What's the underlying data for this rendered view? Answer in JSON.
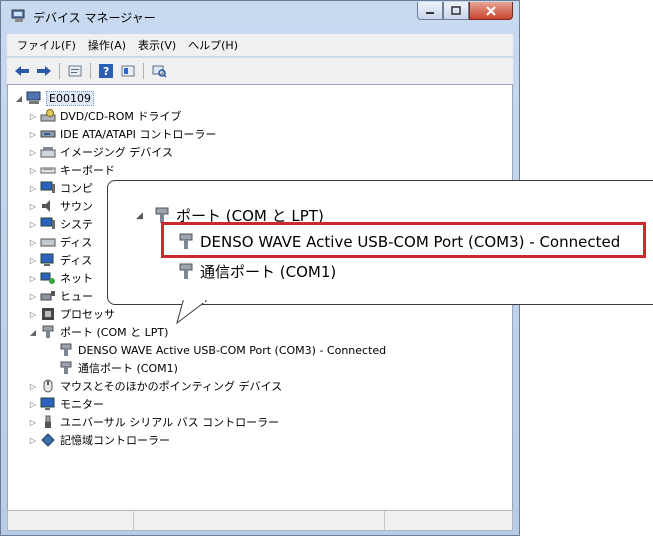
{
  "window": {
    "title": "デバイス マネージャー"
  },
  "menu": [
    "ファイル(F)",
    "操作(A)",
    "表示(V)",
    "ヘルプ(H)"
  ],
  "tree": {
    "root": "E00109",
    "items": [
      "DVD/CD-ROM ドライブ",
      "IDE ATA/ATAPI コントローラー",
      "イメージング デバイス",
      "キーボード",
      "コンピ",
      "サウン",
      "システ",
      "ディス",
      "ディス",
      "ネット",
      "ヒュー",
      "プロセッサ",
      "ポート (COM と LPT)",
      "DENSO WAVE Active USB-COM Port (COM3) - Connected",
      "通信ポート (COM1)",
      "マウスとそのほかのポインティング デバイス",
      "モニター",
      "ユニバーサル シリアル バス コントローラー",
      "記憶域コントローラー"
    ]
  },
  "callout": {
    "port_category": "ポート (COM と LPT)",
    "denso_port": "DENSO WAVE Active USB-COM Port (COM3) - Connected",
    "com1_port": "通信ポート (COM1)"
  },
  "colors": {
    "highlight": "#d0262d"
  }
}
